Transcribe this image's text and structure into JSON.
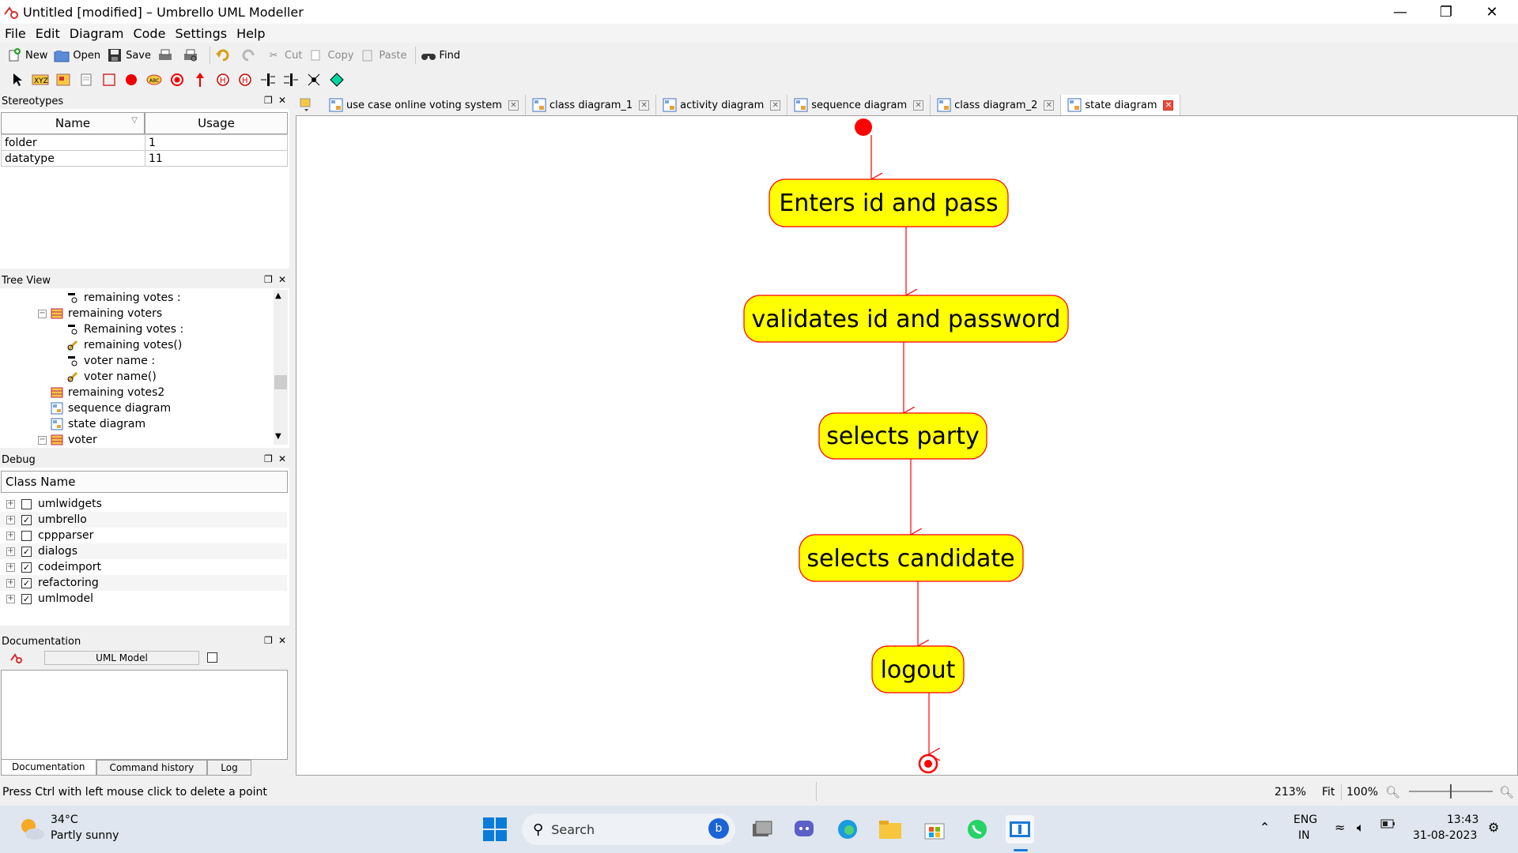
{
  "window": {
    "title": "Untitled [modified] – Umbrello UML Modeller"
  },
  "menu": [
    "File",
    "Edit",
    "Diagram",
    "Code",
    "Settings",
    "Help"
  ],
  "toolbar": {
    "new": "New",
    "open": "Open",
    "save": "Save",
    "cut": "Cut",
    "copy": "Copy",
    "paste": "Paste",
    "find": "Find"
  },
  "stereotypes": {
    "title": "Stereotypes",
    "columns": [
      "Name",
      "Usage"
    ],
    "rows": [
      {
        "name": "folder",
        "usage": "1"
      },
      {
        "name": "datatype",
        "usage": "11"
      }
    ]
  },
  "tree_view": {
    "title": "Tree View",
    "items": [
      {
        "label": "remaining votes :",
        "icon": "attribute-icon"
      },
      {
        "label": "remaining voters",
        "icon": "class-icon"
      },
      {
        "label": "Remaining votes :",
        "icon": "attribute-icon"
      },
      {
        "label": "remaining votes()",
        "icon": "operation-icon"
      },
      {
        "label": "voter name :",
        "icon": "attribute-icon"
      },
      {
        "label": "voter name()",
        "icon": "operation-icon"
      },
      {
        "label": "remaining votes2",
        "icon": "class-icon"
      },
      {
        "label": "sequence diagram",
        "icon": "diagram-icon"
      },
      {
        "label": "state diagram",
        "icon": "diagram-icon"
      },
      {
        "label": "voter",
        "icon": "class-icon"
      }
    ]
  },
  "debug": {
    "title": "Debug",
    "column": "Class Name",
    "rows": [
      {
        "label": "umlwidgets",
        "checked": false
      },
      {
        "label": "umbrello",
        "checked": true
      },
      {
        "label": "cppparser",
        "checked": false
      },
      {
        "label": "dialogs",
        "checked": true
      },
      {
        "label": "codeimport",
        "checked": true
      },
      {
        "label": "refactoring",
        "checked": true
      },
      {
        "label": "umlmodel",
        "checked": true
      }
    ]
  },
  "documentation": {
    "title": "Documentation",
    "field": "UML Model",
    "tabs": [
      "Documentation",
      "Command history",
      "Log"
    ]
  },
  "tabs": [
    {
      "label": "use case online voting system",
      "active": false
    },
    {
      "label": "class diagram_1",
      "active": false
    },
    {
      "label": "activity diagram",
      "active": false
    },
    {
      "label": "sequence diagram",
      "active": false
    },
    {
      "label": "class diagram_2",
      "active": false
    },
    {
      "label": "state diagram",
      "active": true
    }
  ],
  "diagram": {
    "states": [
      "Enters id and pass",
      "validates id and password",
      "selects party",
      "selects candidate",
      "logout"
    ],
    "colors": {
      "state_fill": "#ffff00",
      "state_border": "#ff0000",
      "transition": "#ff0000"
    }
  },
  "status": {
    "message": "Press Ctrl with left mouse click to delete a point",
    "zoom": "213%",
    "fit": "Fit",
    "hundred": "100%"
  },
  "taskbar": {
    "weather_temp": "34°C",
    "weather_desc": "Partly sunny",
    "search": "Search",
    "lang": "ENG",
    "region": "IN",
    "time": "13:43",
    "date": "31-08-2023"
  }
}
